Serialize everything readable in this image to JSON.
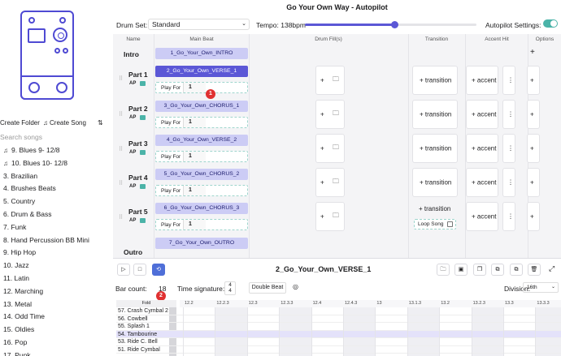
{
  "window": {
    "title": "Go Your Own Way - Autopilot"
  },
  "sidebar": {
    "create_folder": "Create Folder",
    "create_song": "Create Song",
    "search_placeholder": "Search songs",
    "songs": [
      {
        "label": "9. Blues 9- 12/8",
        "icon": "music-note-icon"
      },
      {
        "label": "10. Blues 10- 12/8",
        "icon": "music-note-icon"
      },
      {
        "label": "3. Brazilian",
        "icon": ""
      },
      {
        "label": "4. Brushes Beats",
        "icon": ""
      },
      {
        "label": "5. Country",
        "icon": ""
      },
      {
        "label": "6. Drum & Bass",
        "icon": ""
      },
      {
        "label": "7. Funk",
        "icon": ""
      },
      {
        "label": "8. Hand Percussion BB Mini",
        "icon": ""
      },
      {
        "label": "9. Hip Hop",
        "icon": ""
      },
      {
        "label": "10. Jazz",
        "icon": ""
      },
      {
        "label": "11. Latin",
        "icon": ""
      },
      {
        "label": "12. Marching",
        "icon": ""
      },
      {
        "label": "13. Metal",
        "icon": ""
      },
      {
        "label": "14. Odd Time",
        "icon": ""
      },
      {
        "label": "15. Oldies",
        "icon": ""
      },
      {
        "label": "16. Pop",
        "icon": ""
      },
      {
        "label": "17. Punk",
        "icon": ""
      }
    ]
  },
  "topbar": {
    "drum_set_label": "Drum Set:",
    "drum_set_value": "Standard",
    "tempo_label": "Tempo: 138bpm",
    "tempo_fraction": 0.52,
    "autopilot_label": "Autopilot Settings:",
    "autopilot_on": true
  },
  "columns": {
    "name": "Name",
    "main_beat": "Main Beat",
    "drum_fills": "Drum Fill(s)",
    "transition": "Transition",
    "accent_hit": "Accent Hit",
    "options": "Options"
  },
  "parts": {
    "intro": {
      "label": "Intro",
      "beat": "1_Go_Your_Own_INTRO"
    },
    "p1": {
      "label": "Part 1",
      "ap": "AP",
      "beat": "2_Go_Your_Own_VERSE_1",
      "play_for_label": "Play For",
      "play_for": "1",
      "transition": "+ transition",
      "accent": "+ accent"
    },
    "p2": {
      "label": "Part 2",
      "ap": "AP",
      "beat": "3_Go_Your_Own_CHORUS_1",
      "play_for_label": "Play For",
      "play_for": "1",
      "transition": "+ transition",
      "accent": "+ accent"
    },
    "p3": {
      "label": "Part 3",
      "ap": "AP",
      "beat": "4_Go_Your_Own_VERSE_2",
      "play_for_label": "Play For",
      "play_for": "1",
      "transition": "+ transition",
      "accent": "+ accent"
    },
    "p4": {
      "label": "Part 4",
      "ap": "AP",
      "beat": "5_Go_Your_Own_CHORUS_2",
      "play_for_label": "Play For",
      "play_for": "1",
      "transition": "+ transition",
      "accent": "+ accent"
    },
    "p5": {
      "label": "Part 5",
      "ap": "AP",
      "beat": "6_Go_Your_Own_CHORUS_3",
      "play_for_label": "Play For",
      "play_for": "1",
      "transition": "+ transition",
      "accent": "+ accent",
      "loop_song": "Loop Song"
    },
    "outro": {
      "label": "Outro",
      "beat": "7_Go_Your_Own_OUTRO"
    }
  },
  "badges": {
    "b1": "1",
    "b2": "2"
  },
  "editor": {
    "title": "2_Go_Your_Own_VERSE_1",
    "bar_count_label": "Bar count:",
    "bar_count": "18",
    "time_sig_label": "Time signature:",
    "time_sig_top": "4",
    "time_sig_bottom": "4",
    "double_beat": "Double Beat",
    "division_label": "Division:",
    "division_value": "16th",
    "fold_label": "Fold",
    "ticks": [
      "12.2",
      "12.2.3",
      "12.3",
      "12.3.3",
      "12.4",
      "12.4.3",
      "13",
      "13.1.3",
      "13.2",
      "13.2.3",
      "13.3",
      "13.3.3"
    ],
    "instruments": [
      "57. Crash Cymbal 2",
      "56. Cowbell",
      "55. Splash 1",
      "54. Tambourine",
      "53. Ride C. Bell",
      "51. Ride Cymbal"
    ]
  }
}
